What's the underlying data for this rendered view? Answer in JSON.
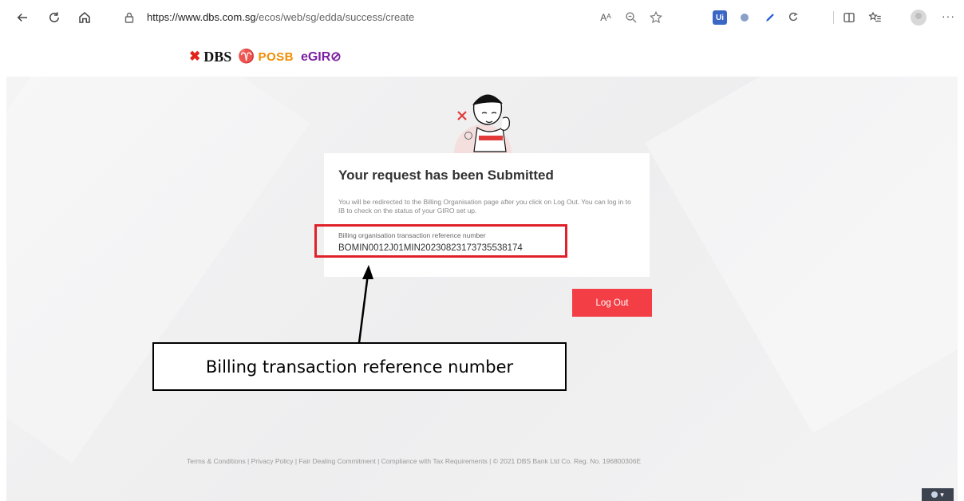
{
  "browser": {
    "url_domain": "https://www.dbs.com.sg",
    "url_path": "/ecos/web/sg/edda/success/create",
    "read_aloud_label": "Aᴬ",
    "ext_ui_label": "Ui",
    "more_label": "···"
  },
  "header": {
    "logo_x": "✖",
    "logo_dbs": "DBS",
    "logo_key": "♈",
    "logo_posb": "POSB",
    "logo_egiro": "eGIR⊘"
  },
  "card": {
    "title": "Your request has been Submitted",
    "message": "You will be redirected to the Billing Organisation page after you click on Log Out. You can log in to IB to check on the status of your GIRO set up.",
    "ref_label": "Billing organisation transaction reference number",
    "ref_value": "BOMIN0012J01MIN20230823173735538174"
  },
  "logout_label": "Log Out",
  "annotation": {
    "callout_text": "Billing transaction reference number"
  },
  "footer": {
    "links": "Terms & Conditions | Privacy Policy | Fair Dealing Commitment | Compliance with Tax Requirements | © 2021 DBS Bank Ltd Co. Reg. No. 196800306E"
  },
  "language_caret": "▾",
  "colors": {
    "accent_red": "#f23e44",
    "highlight_red": "#e0212a",
    "egiro_purple": "#7b1fa2",
    "posb_orange": "#f28b00"
  }
}
